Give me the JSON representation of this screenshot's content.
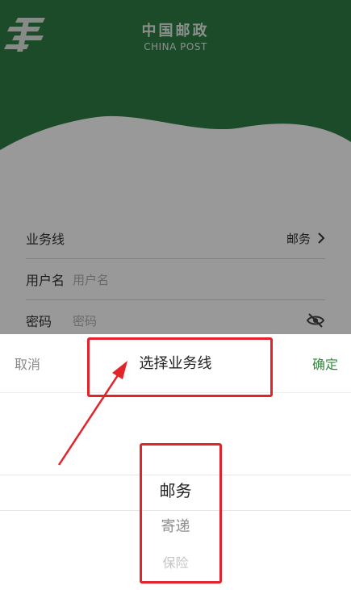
{
  "brand": {
    "name_cn": "中国邮政",
    "name_en": "CHINA POST",
    "color": "#2f7d47"
  },
  "form": {
    "business_line": {
      "label": "业务线",
      "value": "邮务"
    },
    "username": {
      "label": "用户名",
      "placeholder": "用户名"
    },
    "password": {
      "label": "密码",
      "placeholder": "密码"
    }
  },
  "picker": {
    "cancel_label": "取消",
    "title": "选择业务线",
    "confirm_label": "确定",
    "options": [
      "邮务",
      "寄递",
      "保险"
    ],
    "selected": "邮务",
    "accent": "#2e8b3a"
  },
  "annotation": {
    "color": "#e2242a"
  }
}
